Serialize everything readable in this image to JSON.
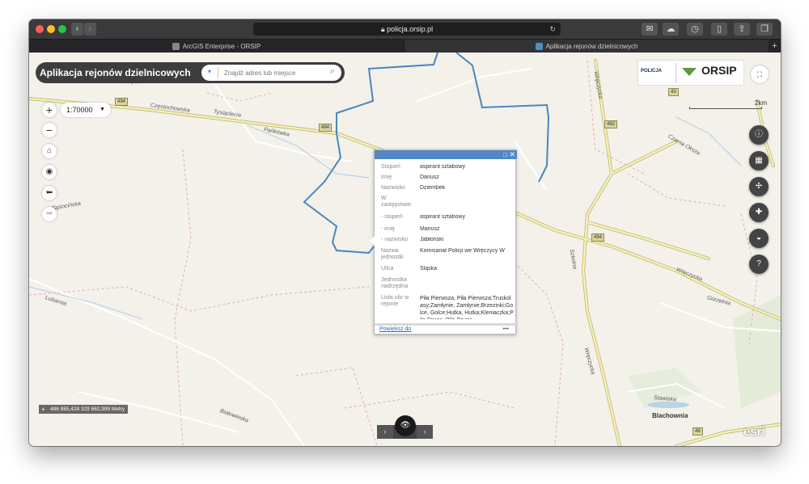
{
  "browser": {
    "url": "policja.orsip.pl",
    "tabs": [
      {
        "label": "ArcGIS Enterprise - ORSIP"
      },
      {
        "label": "Aplikacja rejonów dzielnicowych"
      }
    ],
    "colors": {
      "close": "#ff5f57",
      "minimize": "#febc2e",
      "maximize": "#28c840"
    }
  },
  "app": {
    "title": "Aplikacja rejonów dzielnicowych",
    "search_placeholder": "Znajdź adres lub miejsce",
    "scale": "1:70000",
    "scalebar_label": "2km",
    "coordinates": "486 885,428 329 662,999 Metry",
    "logos": {
      "policja": "POLICJA",
      "orsip": "ORSIP"
    }
  },
  "map": {
    "labels": {
      "czestochowska": "Częstochowska",
      "tysiaclecia": "Tysiąclecia",
      "pankowka": "Pańkówka",
      "wreczycka_top": "Wręczycka",
      "wreczycka_right": "Wręczycka",
      "wreczycka_bottom": "Wręczycka",
      "szkolna": "Szkolna",
      "lebarnia": "Lubarnia",
      "tajseciska": "Tajsocińska",
      "stawiska": "Stawiska",
      "czarna_oksza": "Czarna Oksza",
      "bialowieska": "Białowieska",
      "blachownia": "Blachownia",
      "gorzelnia": "Gorzelnia"
    },
    "road_numbers": {
      "r494_a": "494",
      "r494_b": "494",
      "r492": "492",
      "r43": "43",
      "r46": "46",
      "r494_c": "494"
    }
  },
  "popup": {
    "rows": [
      {
        "label": "Stopień",
        "value": "aspirant sztabowy"
      },
      {
        "label": "Imię",
        "value": "Dariusz"
      },
      {
        "label": "Nazwisko",
        "value": "Dziembek"
      },
      {
        "label": "W zastępstwie:",
        "value": ""
      },
      {
        "label": "- stopień",
        "value": "aspirant sztabowy"
      },
      {
        "label": "- imię",
        "value": "Mariusz"
      },
      {
        "label": "- nazwisko",
        "value": "Jabłoński"
      },
      {
        "label": "Nazwa jednostki",
        "value": "Komisariat Policji we Wręczycy W"
      },
      {
        "label": "Ulica",
        "value": "Śląska"
      },
      {
        "label": "Jednostka nadrzędna",
        "value": ""
      },
      {
        "label": "Lista ulic w rejonie",
        "value": "Piła Pierwsza, Piła Pierwsza;Truskolasy;Zamłynie, Zamłynie;Brzezinki;Golce, Golce;Hutka, Hutka;Kleniaczka;Piła Druga, Piła Druga"
      }
    ],
    "zoom_link": "Powiększ do",
    "more": "•••"
  }
}
